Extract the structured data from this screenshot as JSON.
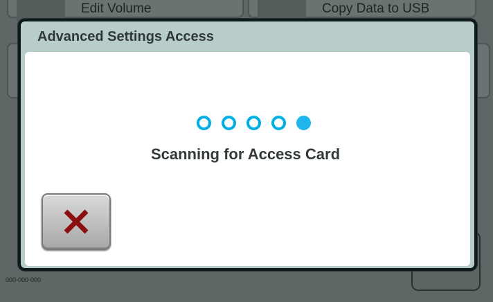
{
  "background": {
    "buttons": [
      {
        "label": "Edit Volume"
      },
      {
        "label": "Copy Data to USB"
      }
    ],
    "serial": "000-000-000"
  },
  "dialog": {
    "title": "Advanced Settings Access",
    "status": "Scanning for Access Card",
    "progress": {
      "total": 5,
      "filled": 1
    },
    "close_icon": "x-icon",
    "colors": {
      "accent": "#00aee6",
      "close_x": "#8b1111",
      "header": "#b8ccca"
    }
  }
}
